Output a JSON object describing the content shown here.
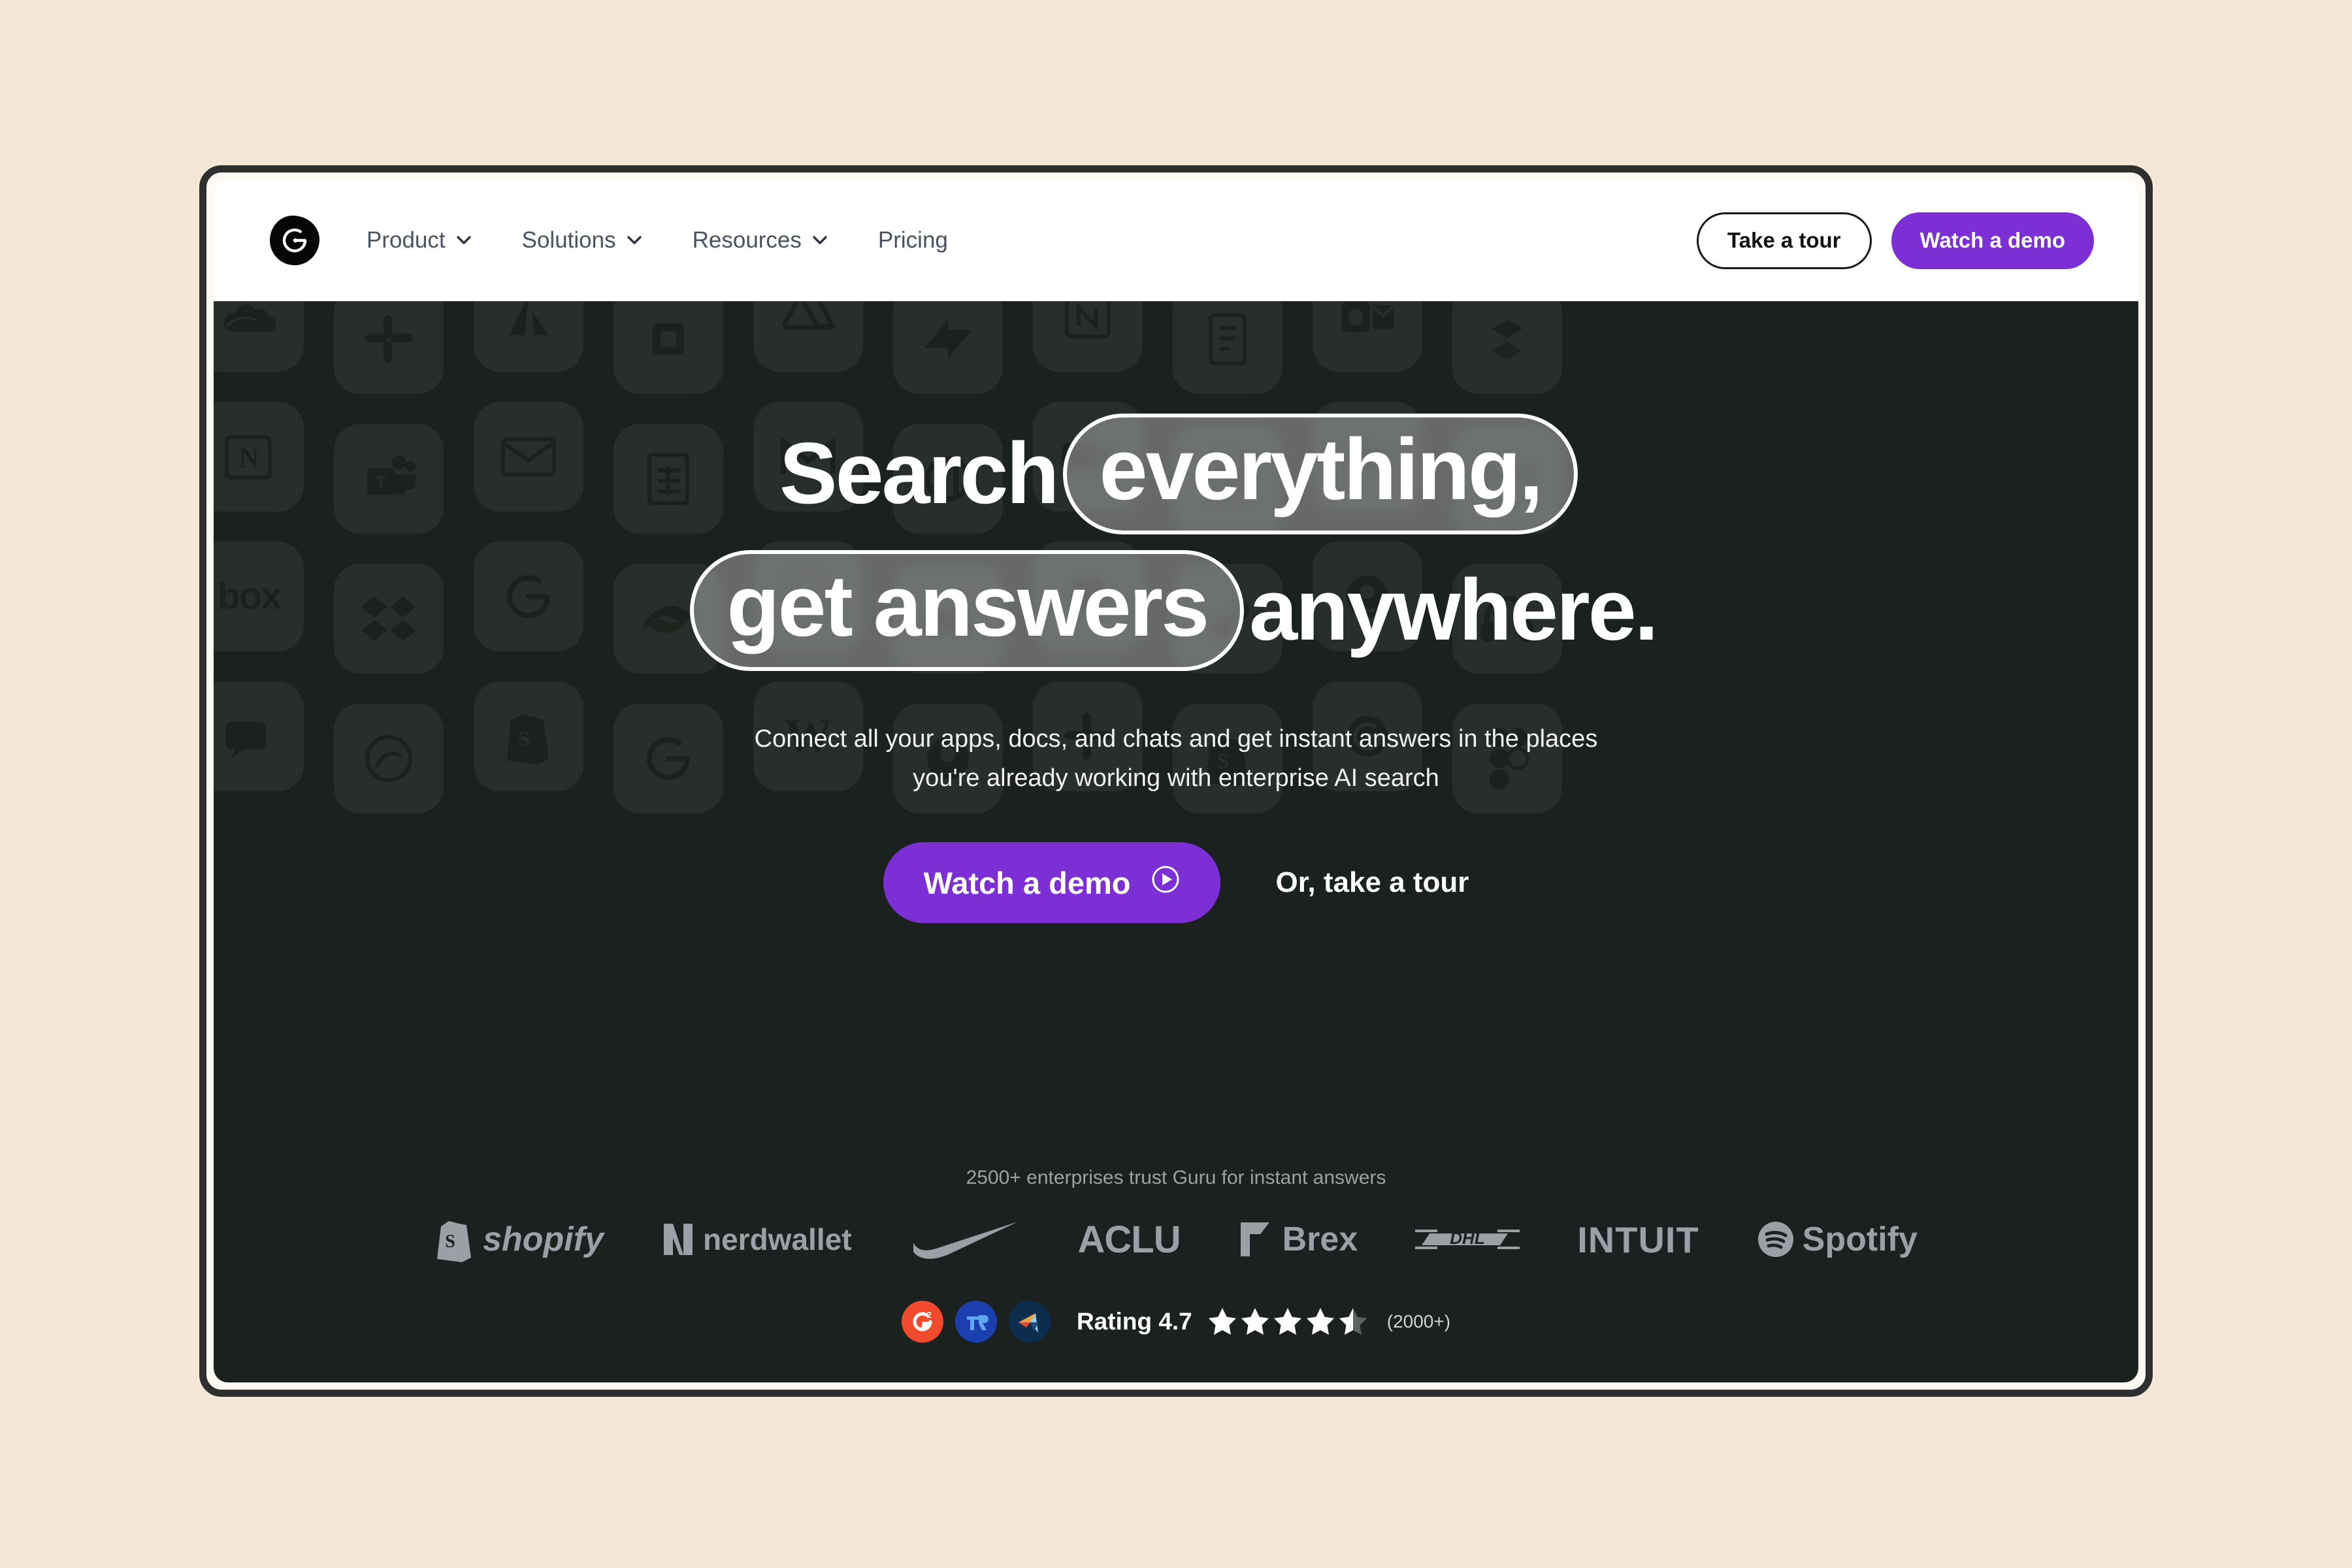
{
  "page": {
    "background_color": "#f5e7d8",
    "frame_border_color": "#2f2f2f"
  },
  "nav": {
    "logo_name": "guru-logo",
    "links": [
      {
        "label": "Product",
        "has_caret": true
      },
      {
        "label": "Solutions",
        "has_caret": true
      },
      {
        "label": "Resources",
        "has_caret": true
      },
      {
        "label": "Pricing",
        "has_caret": false
      }
    ],
    "take_tour_label": "Take a tour",
    "watch_demo_label": "Watch a demo",
    "accent_color": "#7b2fd4",
    "link_color": "#49535f"
  },
  "hero": {
    "background_color": "#1b211f",
    "headline": {
      "line1_plain": "Search",
      "line1_chip": "everything,",
      "line2_chip": "get answers",
      "line2_plain": "anywhere."
    },
    "subheading": "Connect all your apps, docs, and chats and get instant answers in the places you're already working with enterprise AI search",
    "primary_cta": "Watch a demo",
    "primary_cta_icon": "play-circle-icon",
    "secondary_cta": "Or, take a tour",
    "trust_line": "2500+ enterprises trust Guru for instant answers",
    "customer_logos": [
      {
        "name": "shopify",
        "text": "shopify"
      },
      {
        "name": "nerdwallet",
        "text": "nerdwallet"
      },
      {
        "name": "nike",
        "text": ""
      },
      {
        "name": "aclu",
        "text": "ACLU"
      },
      {
        "name": "brex",
        "text": "Brex"
      },
      {
        "name": "dhl",
        "text": "DHL"
      },
      {
        "name": "intuit",
        "text": "INTUIT"
      },
      {
        "name": "spotify",
        "text": "Spotify"
      }
    ],
    "rating": {
      "badges": [
        {
          "name": "g2-badge",
          "color": "#f04b2d"
        },
        {
          "name": "trustradius-badge",
          "color": "#1b3faf"
        },
        {
          "name": "capterra-badge",
          "color": "#0c2d4d"
        }
      ],
      "label": "Rating 4.7",
      "value": 4.7,
      "stars_total": 5,
      "stars_filled": 4.5,
      "count": "(2000+)"
    },
    "background_app_tiles": [
      [
        "onedrive",
        "notion",
        "box",
        "teamwork-chat"
      ],
      [
        "slack",
        "teams",
        "dropbox",
        "asana"
      ],
      [
        "atlassian",
        "gmail-alt",
        "guru-alt",
        "shopify-tile"
      ],
      [
        "jira",
        "sheets",
        "confluence",
        "guru-tile"
      ],
      [
        "google-drive",
        "gmail",
        "google-docs",
        "word"
      ],
      [
        "zendesk",
        "quickbooks",
        "salesforce",
        "github-tile"
      ],
      [
        "notion-alt",
        "zoom",
        "servicenow",
        "slack-alt"
      ],
      [
        "onenote",
        "sheets-alt",
        "hubspot",
        "shopify-alt"
      ],
      [
        "outlook",
        "zendesk-alt",
        "github",
        "guru-round"
      ],
      [
        "dropbox-alt",
        "gmail-m",
        "headphones",
        "figma"
      ]
    ]
  }
}
